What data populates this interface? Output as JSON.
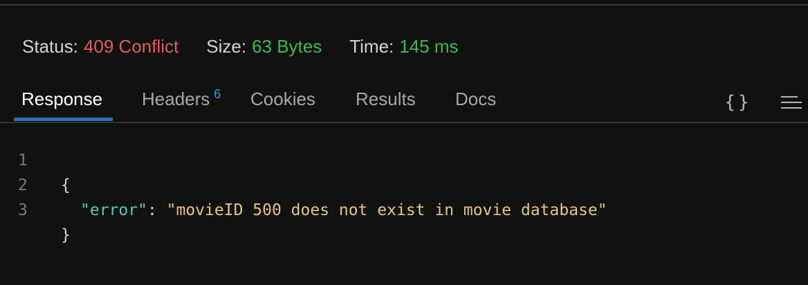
{
  "status": {
    "status_label": "Status:",
    "status_value": "409 Conflict",
    "size_label": "Size:",
    "size_value": "63 Bytes",
    "time_label": "Time:",
    "time_value": "145 ms",
    "colors": {
      "error": "#e05f5f",
      "success": "#3fb950"
    }
  },
  "tabs": {
    "response": "Response",
    "headers": "Headers",
    "headers_count": "6",
    "cookies": "Cookies",
    "results": "Results",
    "docs": "Docs",
    "active": "Response"
  },
  "toolbar": {
    "braces_icon": "braces-icon",
    "braces_glyph": "{}",
    "menu_icon": "menu-icon"
  },
  "code": {
    "lines": [
      {
        "num": "1",
        "open": "{"
      },
      {
        "num": "2",
        "key": "\"error\"",
        "colon": ": ",
        "value": "\"movieID 500 does not exist in movie database\""
      },
      {
        "num": "3",
        "close": "}"
      }
    ]
  }
}
